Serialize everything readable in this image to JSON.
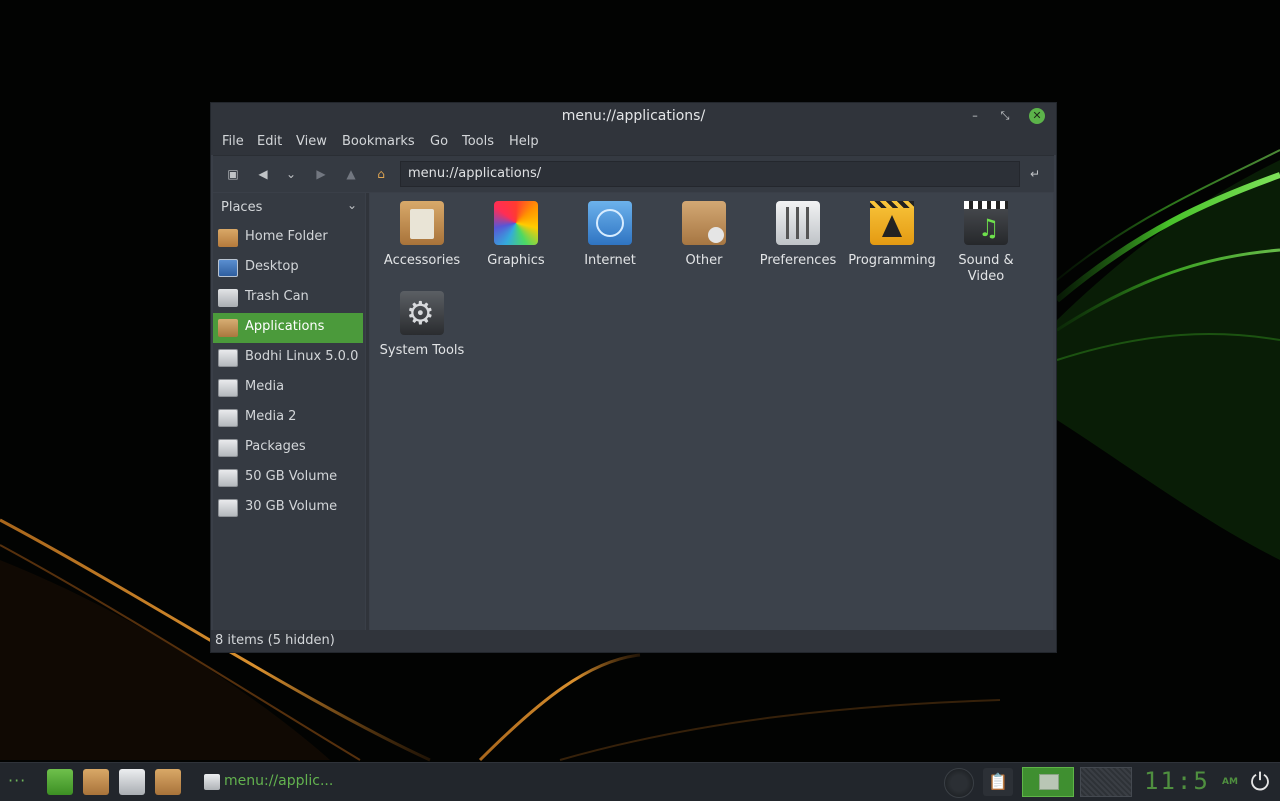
{
  "window": {
    "title": "menu://applications/",
    "buttons": {
      "minimize": "–",
      "maximize": "⤡",
      "close": "✕"
    }
  },
  "menubar": [
    "File",
    "Edit",
    "View",
    "Bookmarks",
    "Go",
    "Tools",
    "Help"
  ],
  "toolbar": {
    "address": "menu://applications/",
    "icons": [
      "terminal-icon",
      "back-arrow-icon",
      "history-dropdown-icon",
      "forward-arrow-icon",
      "up-arrow-icon",
      "home-icon",
      "go-icon"
    ]
  },
  "sidebar": {
    "header": "Places",
    "items": [
      {
        "label": "Home Folder",
        "icon": "home-folder-icon"
      },
      {
        "label": "Desktop",
        "icon": "desktop-icon"
      },
      {
        "label": "Trash Can",
        "icon": "trash-icon"
      },
      {
        "label": "Applications",
        "icon": "applications-icon",
        "active": true
      },
      {
        "label": "Bodhi Linux 5.0.0",
        "icon": "disc-drive-icon"
      },
      {
        "label": "Media",
        "icon": "drive-icon"
      },
      {
        "label": "Media 2",
        "icon": "drive-icon"
      },
      {
        "label": "Packages",
        "icon": "drive-icon"
      },
      {
        "label": "50 GB Volume",
        "icon": "drive-icon"
      },
      {
        "label": "30 GB Volume",
        "icon": "drive-icon"
      }
    ]
  },
  "content": {
    "items": [
      {
        "label": "Accessories",
        "icon": "calculator-icon"
      },
      {
        "label": "Graphics",
        "icon": "color-wheel-icon"
      },
      {
        "label": "Internet",
        "icon": "globe-icon"
      },
      {
        "label": "Other",
        "icon": "package-gear-icon"
      },
      {
        "label": "Preferences",
        "icon": "sliders-icon"
      },
      {
        "label": "Programming",
        "icon": "construction-icon"
      },
      {
        "label": "Sound & Video",
        "icon": "clapper-music-icon"
      },
      {
        "label": "System Tools",
        "icon": "gear-icon"
      }
    ]
  },
  "statusbar": {
    "text": "8 items (5 hidden)"
  },
  "taskbar": {
    "task_label": "menu://applic...",
    "clock": "11:5",
    "ampm": "AM",
    "colors": {
      "accent": "#4b9a3b",
      "clock": "#4f8f3f"
    }
  }
}
